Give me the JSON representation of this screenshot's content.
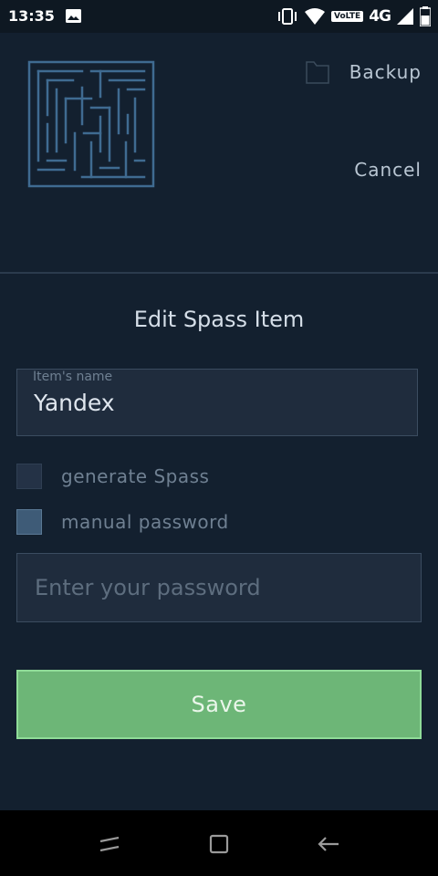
{
  "status_bar": {
    "time": "13:35",
    "network": "4G",
    "volte": "VoLTE",
    "icons": [
      "image-icon",
      "vibrate-icon",
      "wifi-icon",
      "signal-icon",
      "battery-icon"
    ]
  },
  "header": {
    "logo_icon": "maze-logo-icon",
    "backup_label": "Backup",
    "backup_icon": "folder-icon",
    "cancel_label": "Cancel"
  },
  "form": {
    "title": "Edit Spass Item",
    "name_field": {
      "label": "Item's name",
      "value": "Yandex"
    },
    "checkboxes": [
      {
        "label": "generate Spass",
        "checked": false
      },
      {
        "label": "manual password",
        "checked": true
      }
    ],
    "password_field": {
      "placeholder": "Enter your password",
      "value": ""
    },
    "save_label": "Save"
  },
  "colors": {
    "background": "#13202f",
    "accent_button": "#6db677",
    "field_background": "#1f2c3d"
  },
  "navigation_bar": {
    "icons": [
      "recents-icon",
      "home-icon",
      "back-icon"
    ]
  }
}
